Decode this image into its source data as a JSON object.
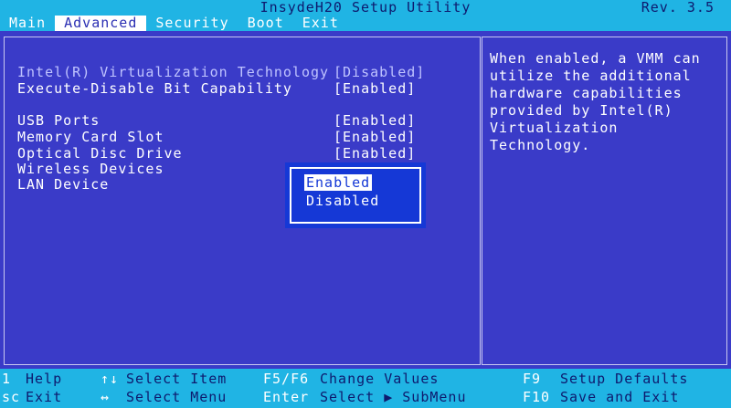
{
  "header": {
    "title": "InsydeH20 Setup Utility",
    "rev": "Rev. 3.5",
    "tabs": [
      "Main",
      "Advanced",
      "Security",
      "Boot",
      "Exit"
    ]
  },
  "settings": [
    {
      "label": "Intel(R) Virtualization Technology",
      "value": "[Disabled]"
    },
    {
      "label": "Execute-Disable Bit Capability",
      "value": "[Enabled]"
    },
    {
      "label": "USB Ports",
      "value": "[Enabled]"
    },
    {
      "label": "Memory Card Slot",
      "value": "[Enabled]"
    },
    {
      "label": "Optical Disc Drive",
      "value": "[Enabled]"
    },
    {
      "label": "Wireless Devices",
      "value": ""
    },
    {
      "label": "LAN Device",
      "value": ""
    }
  ],
  "help": "When enabled, a VMM can utilize the additional hardware capabilities provided by Intel(R) Virtualization Technology.",
  "popup": {
    "options": [
      "Enabled",
      "Disabled"
    ]
  },
  "footer": {
    "items": [
      {
        "key": "1",
        "desc": "Help"
      },
      {
        "key": "sc",
        "desc": "Exit"
      },
      {
        "key": "↑↓",
        "desc": "Select Item"
      },
      {
        "key": "↔",
        "desc": "Select Menu"
      },
      {
        "key": "F5/F6",
        "desc": "Change Values"
      },
      {
        "key": "Enter",
        "desc": "Select ▶ SubMenu"
      },
      {
        "key": "F9",
        "desc": "Setup Defaults"
      },
      {
        "key": "F10",
        "desc": "Save and Exit"
      }
    ]
  },
  "colors": {
    "background": "#3a3bc8",
    "bar": "#20b4e4",
    "popup": "#1538d6"
  }
}
